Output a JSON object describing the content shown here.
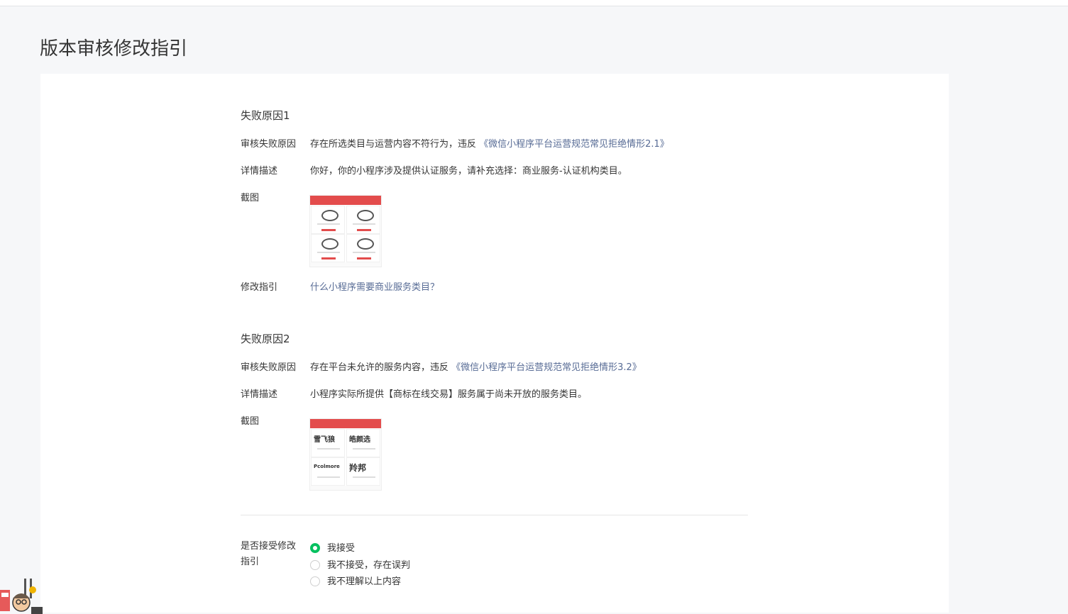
{
  "page_title": "版本审核修改指引",
  "sections": [
    {
      "title": "失败原因1",
      "reason_label": "审核失败原因",
      "reason_text": "存在所选类目与运营内容不符行为，违反",
      "reason_link": "《微信小程序平台运营规范常见拒绝情形2.1》",
      "detail_label": "详情描述",
      "detail_text": "你好，你的小程序涉及提供认证服务，请补充选择：商业服务-认证机构类目。",
      "screenshot_label": "截图",
      "guide_label": "修改指引",
      "guide_link": "什么小程序需要商业服务类目？"
    },
    {
      "title": "失败原因2",
      "reason_label": "审核失败原因",
      "reason_text": "存在平台未允许的服务内容，违反",
      "reason_link": "《微信小程序平台运营规范常见拒绝情形3.2》",
      "detail_label": "详情描述",
      "detail_text": "小程序实际所提供【商标在线交易】服务属于尚未开放的服务类目。",
      "screenshot_label": "截图",
      "thumb_brands": [
        "雪飞狼",
        "皓颜选",
        "Pcolmore",
        "羚邦"
      ]
    }
  ],
  "accept": {
    "label_line1": "是否接受修改",
    "label_line2": "指引",
    "options": [
      "我接受",
      "我不接受，存在误判",
      "我不理解以上内容"
    ],
    "selected": "我接受"
  },
  "colors": {
    "link": "#576b95",
    "accent_green": "#07c160",
    "thumb_red": "#e34c4c"
  }
}
